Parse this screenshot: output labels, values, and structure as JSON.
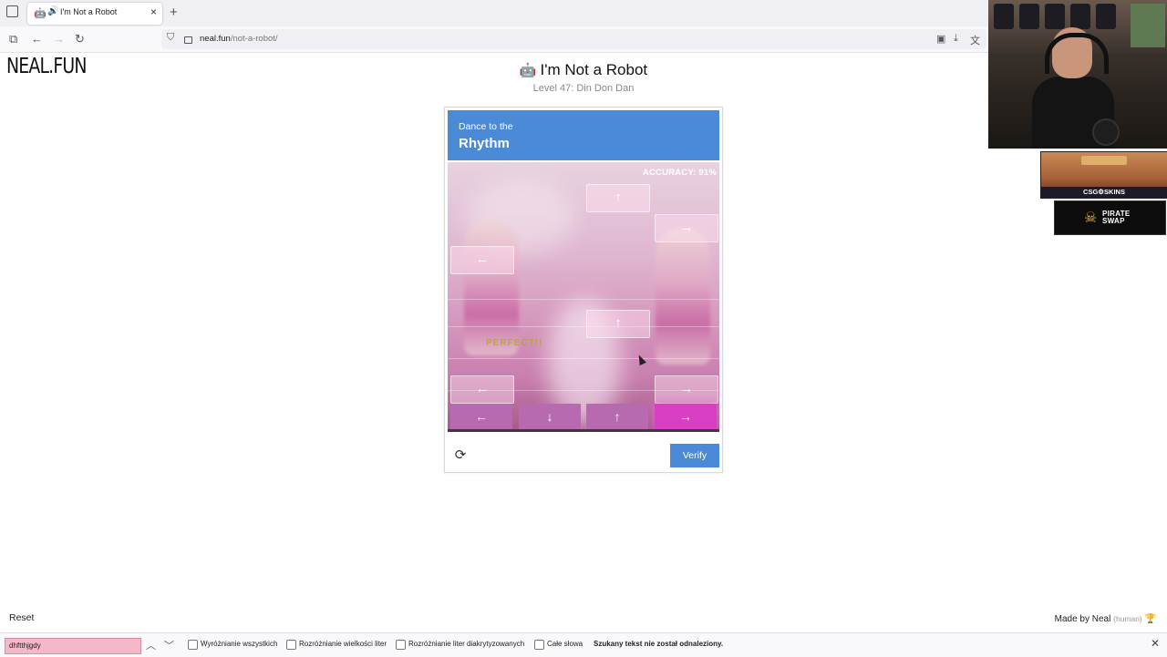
{
  "browser": {
    "tab_title": "I'm Not a Robot",
    "url_host": "neal.fun",
    "url_path": "/not-a-robot/"
  },
  "page": {
    "logo": "NEAL.FUN",
    "title": "I'm Not a Robot",
    "subtitle": "Level 47: Din Don Dan",
    "reset_label": "Reset",
    "made_by": "Made by Neal",
    "made_by_tag": "(human)"
  },
  "captcha": {
    "header_small": "Dance to the",
    "header_big": "Rhythm",
    "accuracy": "ACCURACY: 91%",
    "feedback": "PERFECT!!",
    "notes": [
      {
        "lane": 2,
        "arrow": "↑"
      },
      {
        "lane": 3,
        "arrow": "→"
      },
      {
        "lane": 0,
        "arrow": "←"
      },
      {
        "lane": 2,
        "arrow": "↑"
      },
      {
        "lane": 0,
        "arrow": "←"
      },
      {
        "lane": 3,
        "arrow": "→"
      }
    ],
    "targets": [
      {
        "arrow": "←",
        "active": false
      },
      {
        "arrow": "↓",
        "active": false
      },
      {
        "arrow": "↑",
        "active": false
      },
      {
        "arrow": "→",
        "active": true
      }
    ],
    "verify_label": "Verify"
  },
  "findbar": {
    "query": "dhftthjgdy",
    "options": [
      "Wyróżnianie wszystkich",
      "Rozróżnianie wielkości liter",
      "Rozróżnianie liter diakrytyzowanych",
      "Całe słowa"
    ],
    "status": "Szukany tekst nie został odnaleziony."
  },
  "overlays": {
    "sponsor1_label": "CSG⚙SKINS",
    "sponsor2_line1": "PIRATE",
    "sponsor2_line2": "SWAP"
  },
  "colors": {
    "captcha_blue": "#4a8ad6",
    "target_active": "#d93fc2",
    "find_not_found": "#f5b8c8"
  }
}
